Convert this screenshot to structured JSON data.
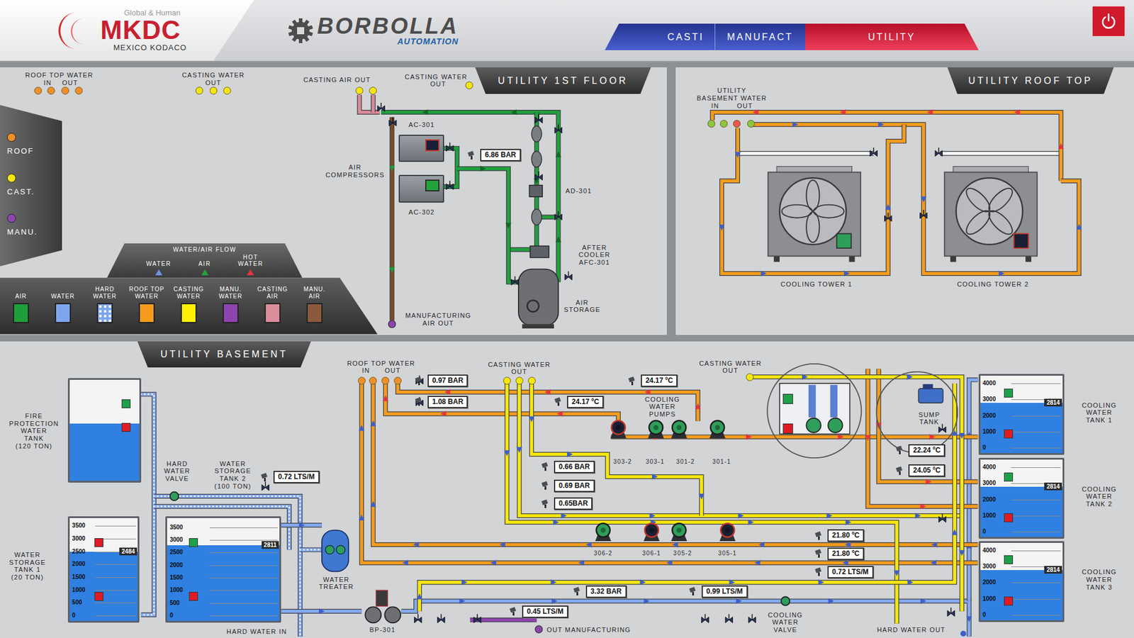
{
  "header": {
    "logo": {
      "tagline": "Global & Human",
      "name": "MKDC",
      "subtitle": "MEXICO KODACO"
    },
    "brand": {
      "name": "BORBOLLA",
      "sub": "AUTOMATION"
    },
    "tabs": [
      {
        "label": "CASTI",
        "selected": false
      },
      {
        "label": "MANUFACT",
        "selected": false
      },
      {
        "label": "UTILITY",
        "selected": true
      }
    ]
  },
  "first_floor": {
    "title": "UTILITY 1ST FLOOR",
    "ports": [
      {
        "title": "ROOF TOP WATER",
        "subs": [
          "IN",
          "OUT"
        ],
        "dots": [
          {
            "color": "#f0902a"
          },
          {
            "color": "#f0902a"
          },
          {
            "color": "#f0902a"
          },
          {
            "color": "#f0902a"
          }
        ]
      },
      {
        "title": "CASTING WATER",
        "subs": [
          "OUT"
        ],
        "dots": [
          {
            "color": "#f6e610"
          },
          {
            "color": "#f6e610"
          },
          {
            "color": "#f6e610"
          }
        ]
      },
      {
        "title": "CASTING AIR OUT",
        "subs": [],
        "dots": [
          {
            "color": "#f6e610"
          },
          {
            "color": "#f6e610"
          }
        ]
      },
      {
        "title": "CASTING WATER",
        "subs": [
          "OUT"
        ],
        "dots": [
          {
            "color": "#f6e610"
          }
        ]
      }
    ],
    "side_menu": [
      {
        "label": "ROOF",
        "color": "#f0902a"
      },
      {
        "label": "CAST.",
        "color": "#f6e610"
      },
      {
        "label": "MANU.",
        "color": "#8e44ad"
      }
    ],
    "flow_legend": {
      "title": "WATER/AIR FLOW",
      "items": [
        {
          "label": "WATER",
          "color": "#6f92e2"
        },
        {
          "label": "AIR",
          "color": "#22a33a"
        },
        {
          "label": "HOT\nWATER",
          "color": "#e8333f"
        }
      ]
    },
    "color_legend": [
      {
        "label": "AIR",
        "color": "#1f9e3c",
        "kind": "solid"
      },
      {
        "label": "WATER",
        "color": "#7ea6ee",
        "kind": "solid"
      },
      {
        "label": "HARD\nWATER",
        "color": "#7ea6ee",
        "kind": "dotted"
      },
      {
        "label": "ROOF TOP\nWATER",
        "color": "#f39c1e",
        "kind": "solid"
      },
      {
        "label": "CASTING\nWATER",
        "color": "#fff200",
        "kind": "solid"
      },
      {
        "label": "MANU.\nWATER",
        "color": "#8e44ad",
        "kind": "solid"
      },
      {
        "label": "CASTING\nAIR",
        "color": "#d98c99",
        "kind": "solid"
      },
      {
        "label": "MANU.\nAIR",
        "color": "#8b5a3c",
        "kind": "solid"
      }
    ],
    "compressors": [
      {
        "name": "AC-301",
        "running": false
      },
      {
        "name": "AC-302",
        "running": true
      }
    ],
    "labels": [
      "AIR\nCOMPRESSORS",
      "AD-301",
      "AFTER\nCOOLER\nAFC-301",
      "AIR\nSTORAGE",
      "MANUFACTURING\nAIR OUT"
    ],
    "pressure": "6.86 BAR"
  },
  "roof_top": {
    "title": "UTILITY ROOF TOP",
    "port": {
      "title": "UTILITY\nBASEMENT WATER",
      "subs": [
        "IN",
        "OUT"
      ],
      "dots": [
        {
          "color": "#8cc63f"
        },
        {
          "color": "#8cc63f"
        },
        {
          "color": "#e8574a"
        },
        {
          "color": "#8cc63f"
        }
      ]
    },
    "towers": [
      {
        "name": "COOLING TOWER 1",
        "running": true
      },
      {
        "name": "COOLING TOWER 2",
        "running": false
      }
    ]
  },
  "basement": {
    "title": "UTILITY BASEMENT",
    "ports": [
      {
        "title": "ROOF TOP WATER",
        "subs": [
          "IN",
          "OUT"
        ],
        "dots": [
          {
            "color": "#f0902a"
          },
          {
            "color": "#f0902a"
          },
          {
            "color": "#f0902a"
          },
          {
            "color": "#f0902a"
          }
        ]
      },
      {
        "title": "CASTING WATER",
        "subs": [
          "OUT"
        ],
        "dots": [
          {
            "color": "#f6e610"
          },
          {
            "color": "#f6e610"
          },
          {
            "color": "#f6e610"
          }
        ]
      },
      {
        "title": "CASTING WATER",
        "subs": [
          "OUT"
        ],
        "dots": [
          {
            "color": "#f6e610"
          }
        ]
      }
    ],
    "fire_tank": {
      "label": "FIRE\nPROTECTION\nWATER\nTANK\n(120 TON)",
      "level": 0.57,
      "indicators": [
        {
          "color": "#1fa04a"
        },
        {
          "color": "#e01b24"
        }
      ]
    },
    "storage_tanks": [
      {
        "label": "WATER\nSTORAGE\nTANK 1\n(20 TON)",
        "scale": [
          "3500",
          "3000",
          "2500",
          "2000",
          "1500",
          "1000",
          "500",
          "0"
        ],
        "value": "2484",
        "level": 0.71,
        "indicators": [
          {
            "color": "#e01b24"
          },
          {
            "color": "#e01b24"
          }
        ]
      },
      {
        "label": "WATER\nSTORAGE\nTANK 2\n(100 TON)",
        "scale": [
          "3500",
          "3000",
          "2500",
          "2000",
          "1500",
          "1000",
          "500",
          "0"
        ],
        "value": "2811",
        "level": 0.8,
        "indicators": [
          {
            "color": "#1fa04a"
          },
          {
            "color": "#e01b24"
          }
        ]
      }
    ],
    "cooling_tanks": [
      {
        "label": "COOLING\nWATER\nTANK 1",
        "scale": [
          "4000",
          "3000",
          "2000",
          "1000",
          "0"
        ],
        "value": "2814",
        "level": 0.7,
        "indicators": [
          {
            "color": "#1fa04a"
          },
          {
            "color": "#e01b24"
          }
        ]
      },
      {
        "label": "COOLING\nWATER\nTANK 2",
        "scale": [
          "4000",
          "3000",
          "2000",
          "1000",
          "0"
        ],
        "value": "2814",
        "level": 0.7,
        "indicators": [
          {
            "color": "#1fa04a"
          },
          {
            "color": "#e01b24"
          }
        ]
      },
      {
        "label": "COOLING\nWATER\nTANK 3",
        "scale": [
          "4000",
          "3000",
          "2000",
          "1000",
          "0"
        ],
        "value": "2814",
        "level": 0.7,
        "indicators": [
          {
            "color": "#1fa04a"
          },
          {
            "color": "#e01b24"
          }
        ]
      }
    ],
    "gauges": [
      "0.72 LTS/M",
      "0.97 BAR",
      "1.08 BAR",
      "24.17 ºC",
      "24.17 ºC",
      "0.66 BAR",
      "0.69 BAR",
      "0.65BAR",
      "22.24 ºC",
      "24.05 ºC",
      "21.80 ºC",
      "21.80 ºC",
      "0.72 LTS/M",
      "3.32 BAR",
      "0.45 LTS/M",
      "0.99 LTS/M"
    ],
    "pumps": [
      {
        "name": "303-2",
        "running": false
      },
      {
        "name": "303-1",
        "running": true
      },
      {
        "name": "301-2",
        "running": true
      },
      {
        "name": "301-1",
        "running": true
      },
      {
        "name": "306-2",
        "running": true
      },
      {
        "name": "306-1",
        "running": false
      },
      {
        "name": "305-2",
        "running": true
      },
      {
        "name": "305-1",
        "running": false
      }
    ],
    "filter": {
      "indicators": [
        {
          "color": "#1fa04a"
        },
        {
          "color": "#e01b24"
        }
      ]
    },
    "labels": [
      "HARD\nWATER\nVALVE",
      "WATER\nTREATER",
      "BP-301",
      "HARD WATER IN",
      "OUT MANUFACTURING",
      "COOLING\nWATER\nVALVE",
      "HARD WATER OUT",
      "COOLING\nWATER\nPUMPS",
      "SUMP\nTANK"
    ]
  }
}
